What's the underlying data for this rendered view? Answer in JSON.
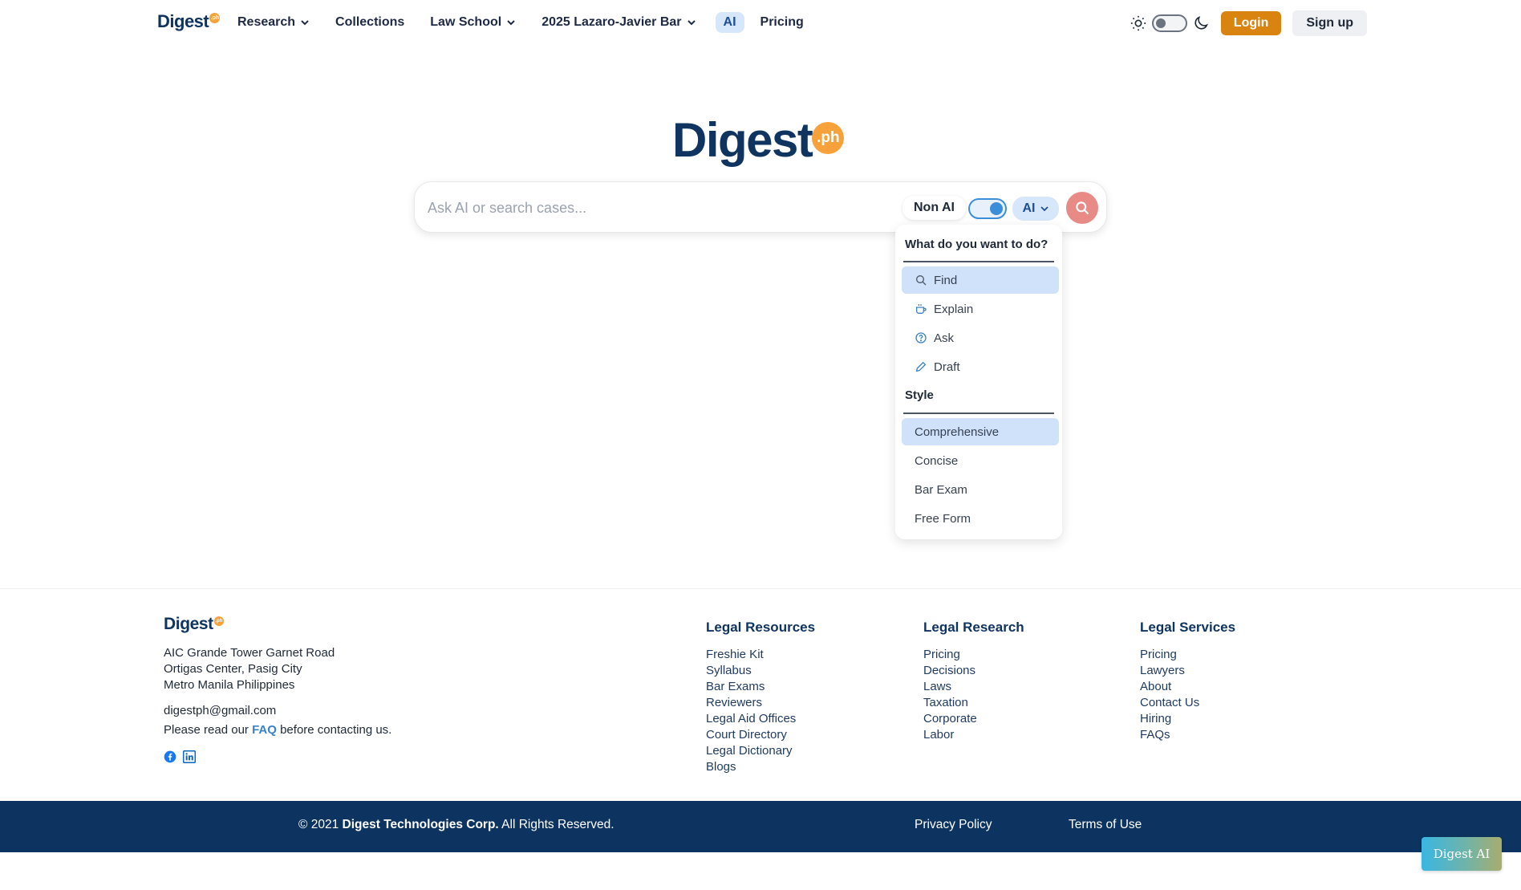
{
  "brand": {
    "name": "Digest",
    "suffix": ".ph"
  },
  "nav": {
    "items": [
      {
        "label": "Research",
        "has_dropdown": true
      },
      {
        "label": "Collections",
        "has_dropdown": false
      },
      {
        "label": "Law School",
        "has_dropdown": true
      },
      {
        "label": "2025 Lazaro-Javier Bar",
        "has_dropdown": true
      },
      {
        "label": "AI",
        "has_dropdown": false,
        "highlighted": true
      },
      {
        "label": "Pricing",
        "has_dropdown": false
      }
    ],
    "theme_toggle_state": "light",
    "login_label": "Login",
    "signup_label": "Sign up"
  },
  "search": {
    "placeholder": "Ask AI or search cases...",
    "value": "",
    "non_ai_label": "Non AI",
    "ai_toggle_on": true,
    "mode_label": "AI"
  },
  "dropdown": {
    "task_heading": "What do you want to do?",
    "tasks": [
      {
        "label": "Find",
        "icon": "search-icon",
        "selected": true
      },
      {
        "label": "Explain",
        "icon": "coffee-icon",
        "selected": false
      },
      {
        "label": "Ask",
        "icon": "help-circle-icon",
        "selected": false
      },
      {
        "label": "Draft",
        "icon": "pencil-icon",
        "selected": false
      }
    ],
    "style_heading": "Style",
    "styles": [
      {
        "label": "Comprehensive",
        "selected": true
      },
      {
        "label": "Concise",
        "selected": false
      },
      {
        "label": "Bar Exam",
        "selected": false
      },
      {
        "label": "Free Form",
        "selected": false
      }
    ]
  },
  "footer": {
    "address": [
      "AIC Grande Tower Garnet Road",
      "Ortigas Center, Pasig City",
      "Metro Manila Philippines"
    ],
    "email": "digestph@gmail.com",
    "note_before": "Please read our ",
    "note_link": "FAQ",
    "note_after": " before contacting us.",
    "columns": [
      {
        "title": "Legal Resources",
        "links": [
          "Freshie Kit",
          "Syllabus",
          "Bar Exams",
          "Reviewers",
          "Legal Aid Offices",
          "Court Directory",
          "Legal Dictionary",
          "Blogs"
        ]
      },
      {
        "title": "Legal Research",
        "links": [
          "Pricing",
          "Decisions",
          "Laws",
          "Taxation",
          "Corporate",
          "Labor"
        ]
      },
      {
        "title": "Legal Services",
        "links": [
          "Pricing",
          "Lawyers",
          "About",
          "Contact Us",
          "Hiring",
          "FAQs"
        ]
      }
    ],
    "copyright_prefix": "© 2021 ",
    "copyright_company": "Digest Technologies Corp.",
    "copyright_suffix": " All Rights Reserved.",
    "privacy_label": "Privacy Policy",
    "terms_label": "Terms of Use"
  },
  "floating_button": "Digest AI",
  "colors": {
    "brand_navy": "#0f3460",
    "brand_orange": "#f6a13a",
    "login_orange": "#d98410",
    "selection_blue": "#cfe2fa",
    "footer_bar": "#0d3460"
  }
}
